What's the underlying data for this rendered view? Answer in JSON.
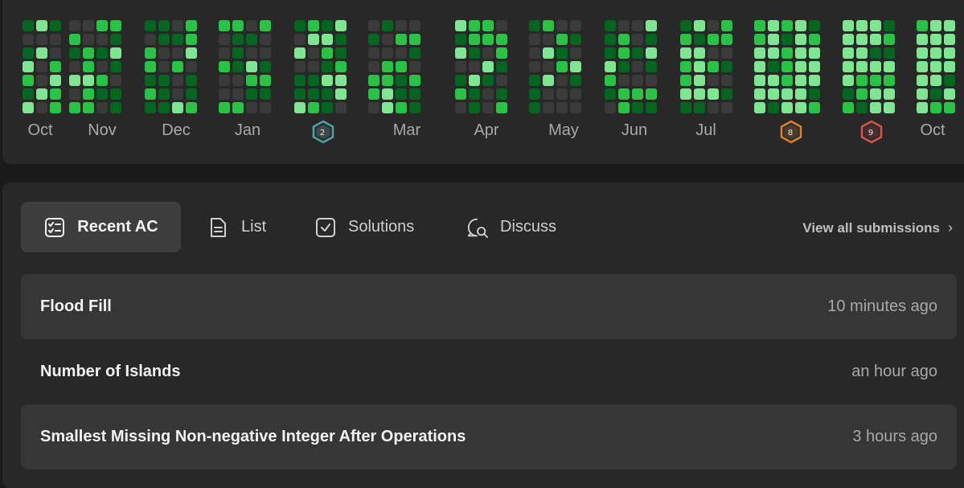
{
  "heatmap": {
    "months": [
      "Oct",
      "Nov",
      "Dec",
      "Jan",
      "Feb",
      "Mar",
      "Apr",
      "May",
      "Jun",
      "Jul",
      "Aug",
      "Sep",
      "Oct"
    ],
    "badges": [
      {
        "month": "Feb",
        "number": "2",
        "color": "#4aa3a8"
      },
      {
        "month": "Aug",
        "number": "8",
        "color": "#d9822b"
      },
      {
        "month": "Sep",
        "number": "9",
        "color": "#d9534f"
      }
    ],
    "colors": {
      "empty": "#3a3a3a",
      "low": "#016620",
      "mid": "#28c244",
      "high": "#7ee591"
    }
  },
  "tabs": [
    {
      "label": "Recent AC",
      "icon": "checklist-icon",
      "active": true
    },
    {
      "label": "List",
      "icon": "document-icon",
      "active": false
    },
    {
      "label": "Solutions",
      "icon": "check-square-icon",
      "active": false
    },
    {
      "label": "Discuss",
      "icon": "chat-search-icon",
      "active": false
    }
  ],
  "view_all": {
    "label": "View all submissions",
    "icon": "chevron-right-icon"
  },
  "submissions": [
    {
      "title": "Flood Fill",
      "time": "10 minutes ago"
    },
    {
      "title": "Number of Islands",
      "time": "an hour ago"
    },
    {
      "title": "Smallest Missing Non-negative Integer After Operations",
      "time": "3 hours ago"
    }
  ]
}
